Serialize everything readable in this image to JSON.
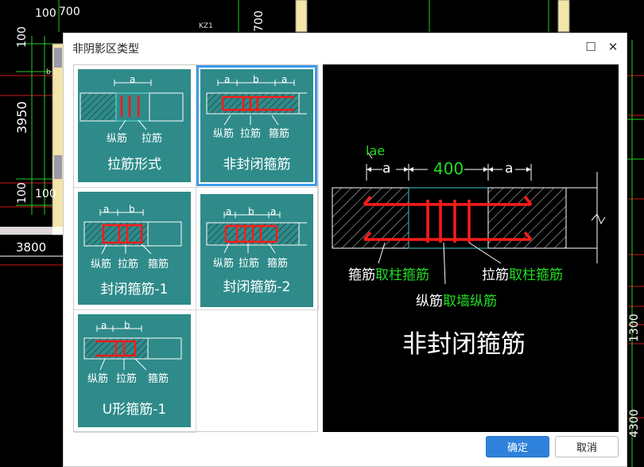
{
  "background": {
    "dims": [
      "100",
      "700",
      "100",
      "3950",
      "100",
      "100",
      "3800",
      "700",
      "1300",
      "4300"
    ],
    "small_labels": [
      "KZ1",
      "b"
    ]
  },
  "dialog": {
    "title": "非阴影区类型",
    "maximize_glyph": "☐",
    "close_glyph": "✕",
    "tiles": [
      {
        "label": "拉筋形式",
        "dims": "a",
        "sub": [
          "纵筋",
          "拉筋"
        ]
      },
      {
        "label": "非封闭箍筋",
        "dims": [
          "a",
          "b",
          "a"
        ],
        "sub": [
          "纵筋",
          "拉筋",
          "箍筋"
        ],
        "selected": true
      },
      {
        "label": "封闭箍筋-1",
        "dims": [
          "a",
          "b"
        ],
        "sub": [
          "纵筋",
          "拉筋",
          "箍筋"
        ]
      },
      {
        "label": "封闭箍筋-2",
        "dims": [
          "a",
          "b",
          "a"
        ],
        "sub": [
          "纵筋",
          "拉筋",
          "箍筋"
        ]
      },
      {
        "label": "U形箍筋-1",
        "dims": [
          "a",
          "b"
        ],
        "sub": [
          "纵筋",
          "拉筋",
          "箍筋"
        ]
      }
    ],
    "preview": {
      "lae": "lae",
      "dim_a": "a",
      "dim_mid": "400",
      "stirrup_label": "箍筋",
      "stirrup_value": "取柱箍筋",
      "tie_label": "拉筋",
      "tie_value": "取柱箍筋",
      "long_label": "纵筋",
      "long_value": "取墙纵筋",
      "caption": "非封闭箍筋"
    },
    "ok_label": "确定",
    "cancel_label": "取消"
  },
  "colors": {
    "tile": "#2e8b8a",
    "select": "#3c9be8",
    "rebar": "#ff1a1a",
    "green": "#22dd22",
    "primary": "#2f82db"
  }
}
